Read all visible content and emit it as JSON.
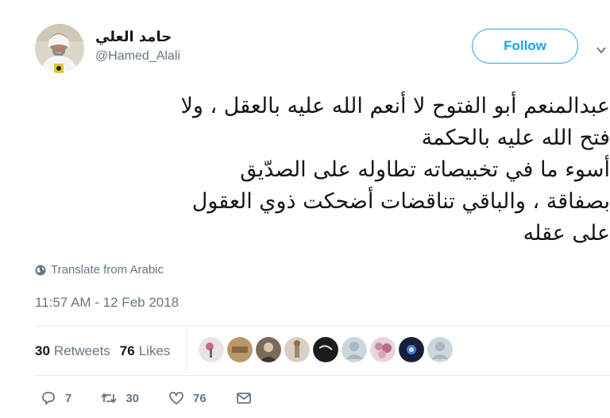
{
  "author": {
    "display_name": "حامد العلي",
    "handle": "@Hamed_Alali"
  },
  "follow_button": {
    "label": "Follow"
  },
  "tweet": {
    "lines": [
      "عبدالمنعم أبو الفتوح لا أنعم الله عليه بالعقل ، ولا",
      "فتح الله عليه بالحكمة",
      "أسوء ما في تخبيصاته تطاوله على الصدّيق",
      "بصفاقة ، والباقي تناقضات أضحكت ذوي العقول",
      "على عقله"
    ]
  },
  "translate": {
    "label": "Translate from Arabic",
    "icon": "globe-icon"
  },
  "timestamp": "11:57 AM - 12 Feb 2018",
  "stats": {
    "retweets_count": "30",
    "retweets_label": "Retweets",
    "likes_count": "76",
    "likes_label": "Likes"
  },
  "likers": [
    {
      "color": "#c9a3ad"
    },
    {
      "color": "#b7986a"
    },
    {
      "color": "#7a6a5c"
    },
    {
      "color": "#b9a899"
    },
    {
      "color": "#1c1c1c"
    },
    {
      "color": "#aab8c2"
    },
    {
      "color": "#c68aa8"
    },
    {
      "color": "#16203a"
    },
    {
      "color": "#aab8c2"
    }
  ],
  "actions": {
    "reply_count": "7",
    "retweet_count": "30",
    "like_count": "76"
  },
  "colors": {
    "accent": "#1da1f2",
    "secondary_text": "#657786",
    "divider": "#e6ecf0"
  }
}
